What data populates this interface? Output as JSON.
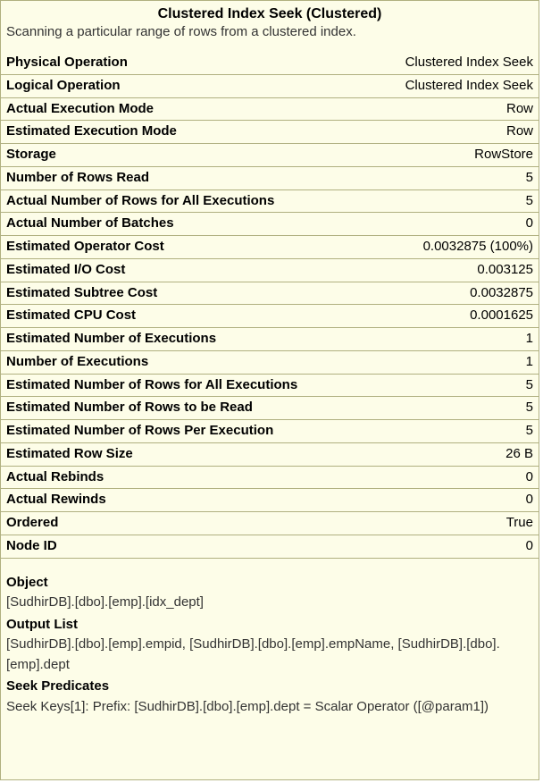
{
  "title": "Clustered Index Seek (Clustered)",
  "description": "Scanning a particular range of rows from a clustered index.",
  "properties": [
    {
      "label": "Physical Operation",
      "value": "Clustered Index Seek"
    },
    {
      "label": "Logical Operation",
      "value": "Clustered Index Seek"
    },
    {
      "label": "Actual Execution Mode",
      "value": "Row"
    },
    {
      "label": "Estimated Execution Mode",
      "value": "Row"
    },
    {
      "label": "Storage",
      "value": "RowStore"
    },
    {
      "label": "Number of Rows Read",
      "value": "5"
    },
    {
      "label": "Actual Number of Rows for All Executions",
      "value": "5"
    },
    {
      "label": "Actual Number of Batches",
      "value": "0"
    },
    {
      "label": "Estimated Operator Cost",
      "value": "0.0032875 (100%)"
    },
    {
      "label": "Estimated I/O Cost",
      "value": "0.003125"
    },
    {
      "label": "Estimated Subtree Cost",
      "value": "0.0032875"
    },
    {
      "label": "Estimated CPU Cost",
      "value": "0.0001625"
    },
    {
      "label": "Estimated Number of Executions",
      "value": "1"
    },
    {
      "label": "Number of Executions",
      "value": "1"
    },
    {
      "label": "Estimated Number of Rows for All Executions",
      "value": "5"
    },
    {
      "label": "Estimated Number of Rows to be Read",
      "value": "5"
    },
    {
      "label": "Estimated Number of Rows Per Execution",
      "value": "5"
    },
    {
      "label": "Estimated Row Size",
      "value": "26 B"
    },
    {
      "label": "Actual Rebinds",
      "value": "0"
    },
    {
      "label": "Actual Rewinds",
      "value": "0"
    },
    {
      "label": "Ordered",
      "value": "True"
    },
    {
      "label": "Node ID",
      "value": "0"
    }
  ],
  "sections": [
    {
      "label": "Object",
      "text": "[SudhirDB].[dbo].[emp].[idx_dept]"
    },
    {
      "label": "Output List",
      "text": "[SudhirDB].[dbo].[emp].empid, [SudhirDB].[dbo].[emp].empName, [SudhirDB].[dbo].[emp].dept"
    },
    {
      "label": "Seek Predicates",
      "text": "Seek Keys[1]: Prefix: [SudhirDB].[dbo].[emp].dept = Scalar Operator ([@param1])"
    }
  ]
}
